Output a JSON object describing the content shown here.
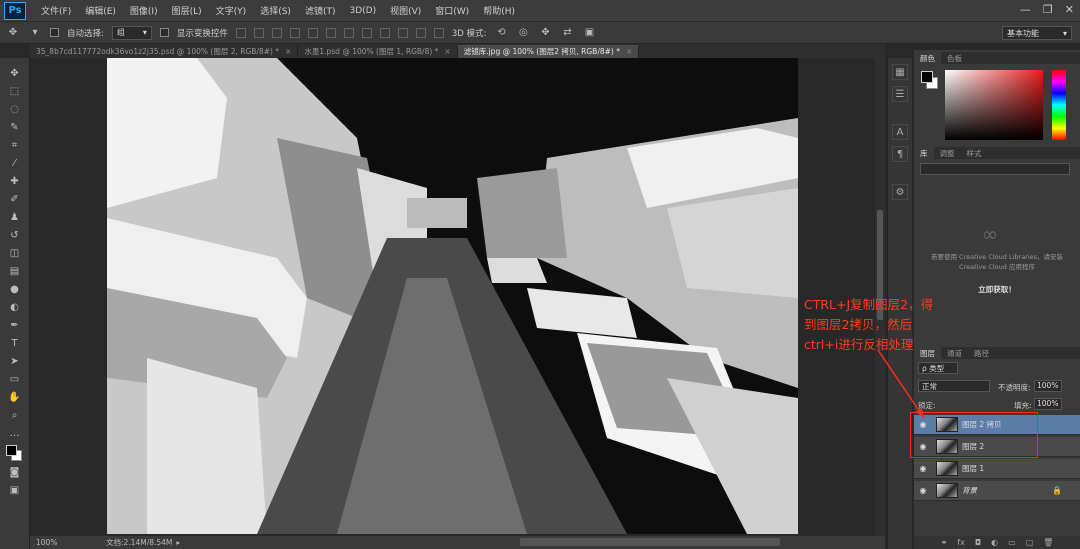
{
  "app": {
    "logo": "Ps"
  },
  "menu": [
    "文件(F)",
    "编辑(E)",
    "图像(I)",
    "图层(L)",
    "文字(Y)",
    "选择(S)",
    "滤镜(T)",
    "3D(D)",
    "视图(V)",
    "窗口(W)",
    "帮助(H)"
  ],
  "window_controls": [
    "—",
    "❐",
    "✕"
  ],
  "options": {
    "auto_select_label": "自动选择:",
    "auto_select_value": "组",
    "show_transform_label": "显示变换控件",
    "mode_3d_label": "3D 模式:",
    "workspace": "基本功能"
  },
  "tabs": [
    {
      "label": "35_8b7cd117772odk36vo1z2j35.psd @ 100% (图层 2, RGB/8#) *"
    },
    {
      "label": "水墨1.psd @ 100% (图层 1, RGB/8) *"
    },
    {
      "label": "滤镜库.jpg @ 100% (图层2 拷贝, RGB/8#) *"
    }
  ],
  "status": {
    "zoom": "100%",
    "doc_info": "文档:2.14M/8.54M"
  },
  "color_panel": {
    "tabs": [
      "颜色",
      "色板"
    ]
  },
  "library_panel": {
    "tabs": [
      "库",
      "调整",
      "样式"
    ],
    "message": "若要使用 Creative Cloud Libraries，请安装 Creative Cloud 应用程序",
    "link": "立即获取！"
  },
  "layers_panel": {
    "tabs": [
      "图层",
      "通道",
      "路径"
    ],
    "kind_filter": "ρ 类型",
    "blend_mode": "正常",
    "opacity_label": "不透明度:",
    "opacity_value": "100%",
    "lock_label": "锁定:",
    "fill_label": "填充:",
    "fill_value": "100%",
    "layers": [
      {
        "name": "图层 2 拷贝",
        "selected": true
      },
      {
        "name": "图层 2",
        "selected": false
      },
      {
        "name": "图层 1",
        "selected": false
      },
      {
        "name": "背景",
        "selected": false,
        "locked": true
      }
    ]
  },
  "annotation": {
    "line1": "CTRL+J复制图层2，得",
    "line2": "到图层2拷贝，然后",
    "line3": "ctrl+i进行反相处理"
  }
}
